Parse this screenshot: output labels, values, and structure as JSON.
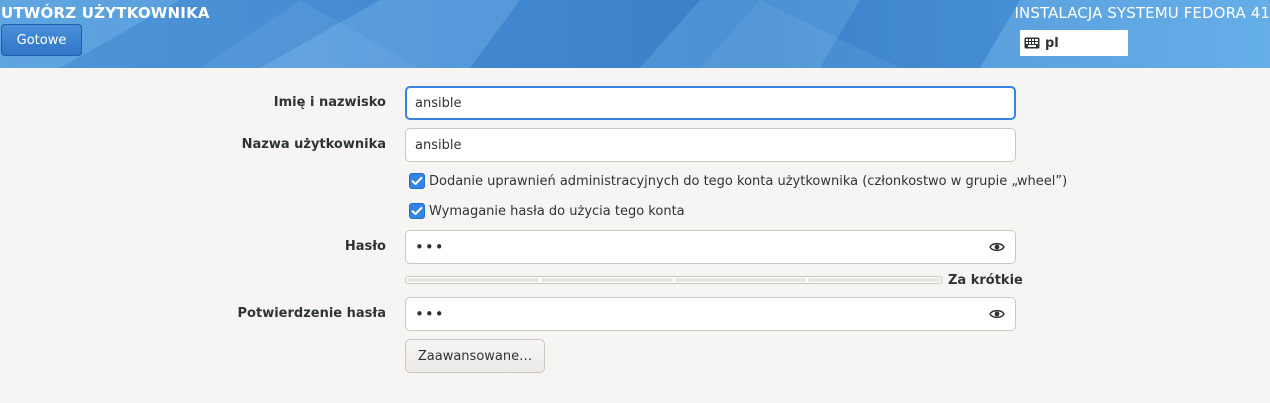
{
  "header": {
    "page_title": "UTWÓRZ UŻYTKOWNIKA",
    "done_label": "Gotowe",
    "install_title": "INSTALACJA SYSTEMU FEDORA 41",
    "keyboard_layout": "pl",
    "keyboard_icon": "keyboard-icon"
  },
  "form": {
    "full_name": {
      "label": "Imię i nazwisko",
      "value": "ansible"
    },
    "username": {
      "label": "Nazwa użytkownika",
      "value": "ansible"
    },
    "admin_checkbox": {
      "label": "Dodanie uprawnień administracyjnych do tego konta użytkownika (członkostwo w grupie „wheel”)",
      "checked": true
    },
    "require_password_checkbox": {
      "label": "Wymaganie hasła do użycia tego konta",
      "checked": true
    },
    "password": {
      "label": "Hasło",
      "value": "•••",
      "reveal_icon": "eye-icon"
    },
    "strength": {
      "label": "Za krótkie",
      "segments": 4,
      "filled": 0
    },
    "confirm_password": {
      "label": "Potwierdzenie hasła",
      "value": "•••",
      "reveal_icon": "eye-icon"
    },
    "advanced_label": "Zaawansowane…"
  },
  "colors": {
    "accent": "#3584e4",
    "header_blue": "#4a8fd4"
  }
}
